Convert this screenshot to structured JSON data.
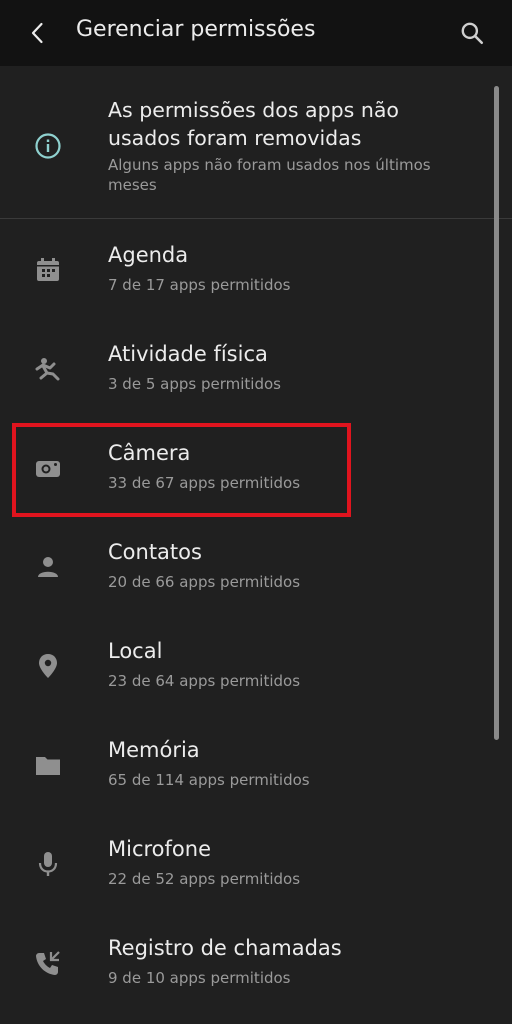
{
  "app_bar": {
    "title": "Gerenciar permissões",
    "back_icon": "chevron-left-icon",
    "search_icon": "search-icon"
  },
  "notice": {
    "icon": "info-icon",
    "title": "As permissões dos apps não usados foram removidas",
    "subtitle": "Alguns apps não foram usados nos últimos meses"
  },
  "permissions": [
    {
      "icon": "calendar-icon",
      "title": "Agenda",
      "subtitle": "7 de 17 apps permitidos"
    },
    {
      "icon": "physical-activity-icon",
      "title": "Atividade física",
      "subtitle": "3 de 5 apps permitidos"
    },
    {
      "icon": "camera-icon",
      "title": "Câmera",
      "subtitle": "33 de 67 apps permitidos"
    },
    {
      "icon": "person-icon",
      "title": "Contatos",
      "subtitle": "20 de 66 apps permitidos"
    },
    {
      "icon": "location-pin-icon",
      "title": "Local",
      "subtitle": "23 de 64 apps permitidos"
    },
    {
      "icon": "folder-icon",
      "title": "Memória",
      "subtitle": "65 de 114 apps permitidos"
    },
    {
      "icon": "microphone-icon",
      "title": "Microfone",
      "subtitle": "22 de 52 apps permitidos"
    },
    {
      "icon": "call-log-icon",
      "title": "Registro de chamadas",
      "subtitle": "9 de 10 apps permitidos"
    }
  ],
  "colors": {
    "background": "#202020",
    "app_bar": "#121212",
    "icon_gray": "#8f8f8f",
    "info_accent": "#8fd1cf",
    "highlight": "#e0141e"
  }
}
